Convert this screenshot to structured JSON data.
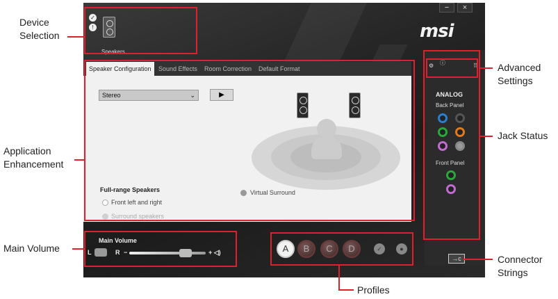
{
  "callouts": {
    "device_selection": [
      "Device",
      "Selection"
    ],
    "application_enhancement": [
      "Application",
      "Enhancement"
    ],
    "main_volume": "Main Volume",
    "advanced_settings": [
      "Advanced",
      "Settings"
    ],
    "jack_status": "Jack Status",
    "connector_strings": [
      "Connector",
      "Strings"
    ],
    "profiles": "Profiles"
  },
  "window": {
    "minimize": "−",
    "close": "×",
    "logo": "msi"
  },
  "device": {
    "label": "Speakers",
    "icons": [
      "check-circle-icon",
      "info-circle-icon",
      "speaker-icon"
    ]
  },
  "tabs": [
    {
      "label": "Speaker Configuration",
      "active": true
    },
    {
      "label": "Sound Effects",
      "active": false
    },
    {
      "label": "Room Correction",
      "active": false
    },
    {
      "label": "Default Format",
      "active": false
    }
  ],
  "speaker_config": {
    "mode": "Stereo",
    "play_icon": "▶",
    "section_title": "Full-range Speakers",
    "options": [
      "Front left and right",
      "Surround speakers"
    ],
    "virtual_surround": "Virtual Surround"
  },
  "volume": {
    "title": "Main Volume",
    "left": "L",
    "right": "R",
    "minus": "−",
    "plus": "+ ◁)"
  },
  "profiles": [
    "A",
    "B",
    "C",
    "D"
  ],
  "jacks": {
    "analog": "ANALOG",
    "back_panel": "Back Panel",
    "front_panel": "Front Panel",
    "back_colors": [
      "#2a7fd0",
      "#555555",
      "#2aa83a",
      "#e07a1c",
      "#c26bd0",
      "#888888"
    ],
    "front_colors": [
      "#2aa83a",
      "#c26bd0"
    ]
  },
  "connector": "→c",
  "colors": {
    "highlight": "#e0202c"
  }
}
